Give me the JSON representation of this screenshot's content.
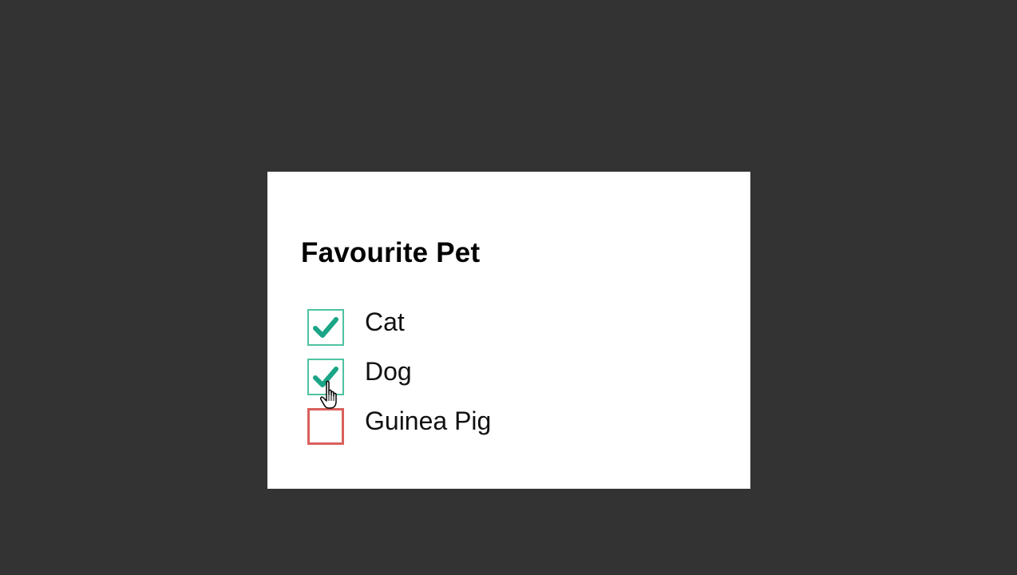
{
  "form": {
    "title": "Favourite Pet",
    "options": [
      {
        "label": "Cat",
        "checked": true
      },
      {
        "label": "Dog",
        "checked": true
      },
      {
        "label": "Guinea Pig",
        "checked": false
      }
    ]
  },
  "colors": {
    "background": "#333333",
    "card": "#ffffff",
    "check_accent": "#1aa586",
    "checked_border": "#4fc3a1",
    "unchecked_border": "#d9605a"
  },
  "cursor": {
    "icon": "hand-pointer-icon"
  }
}
